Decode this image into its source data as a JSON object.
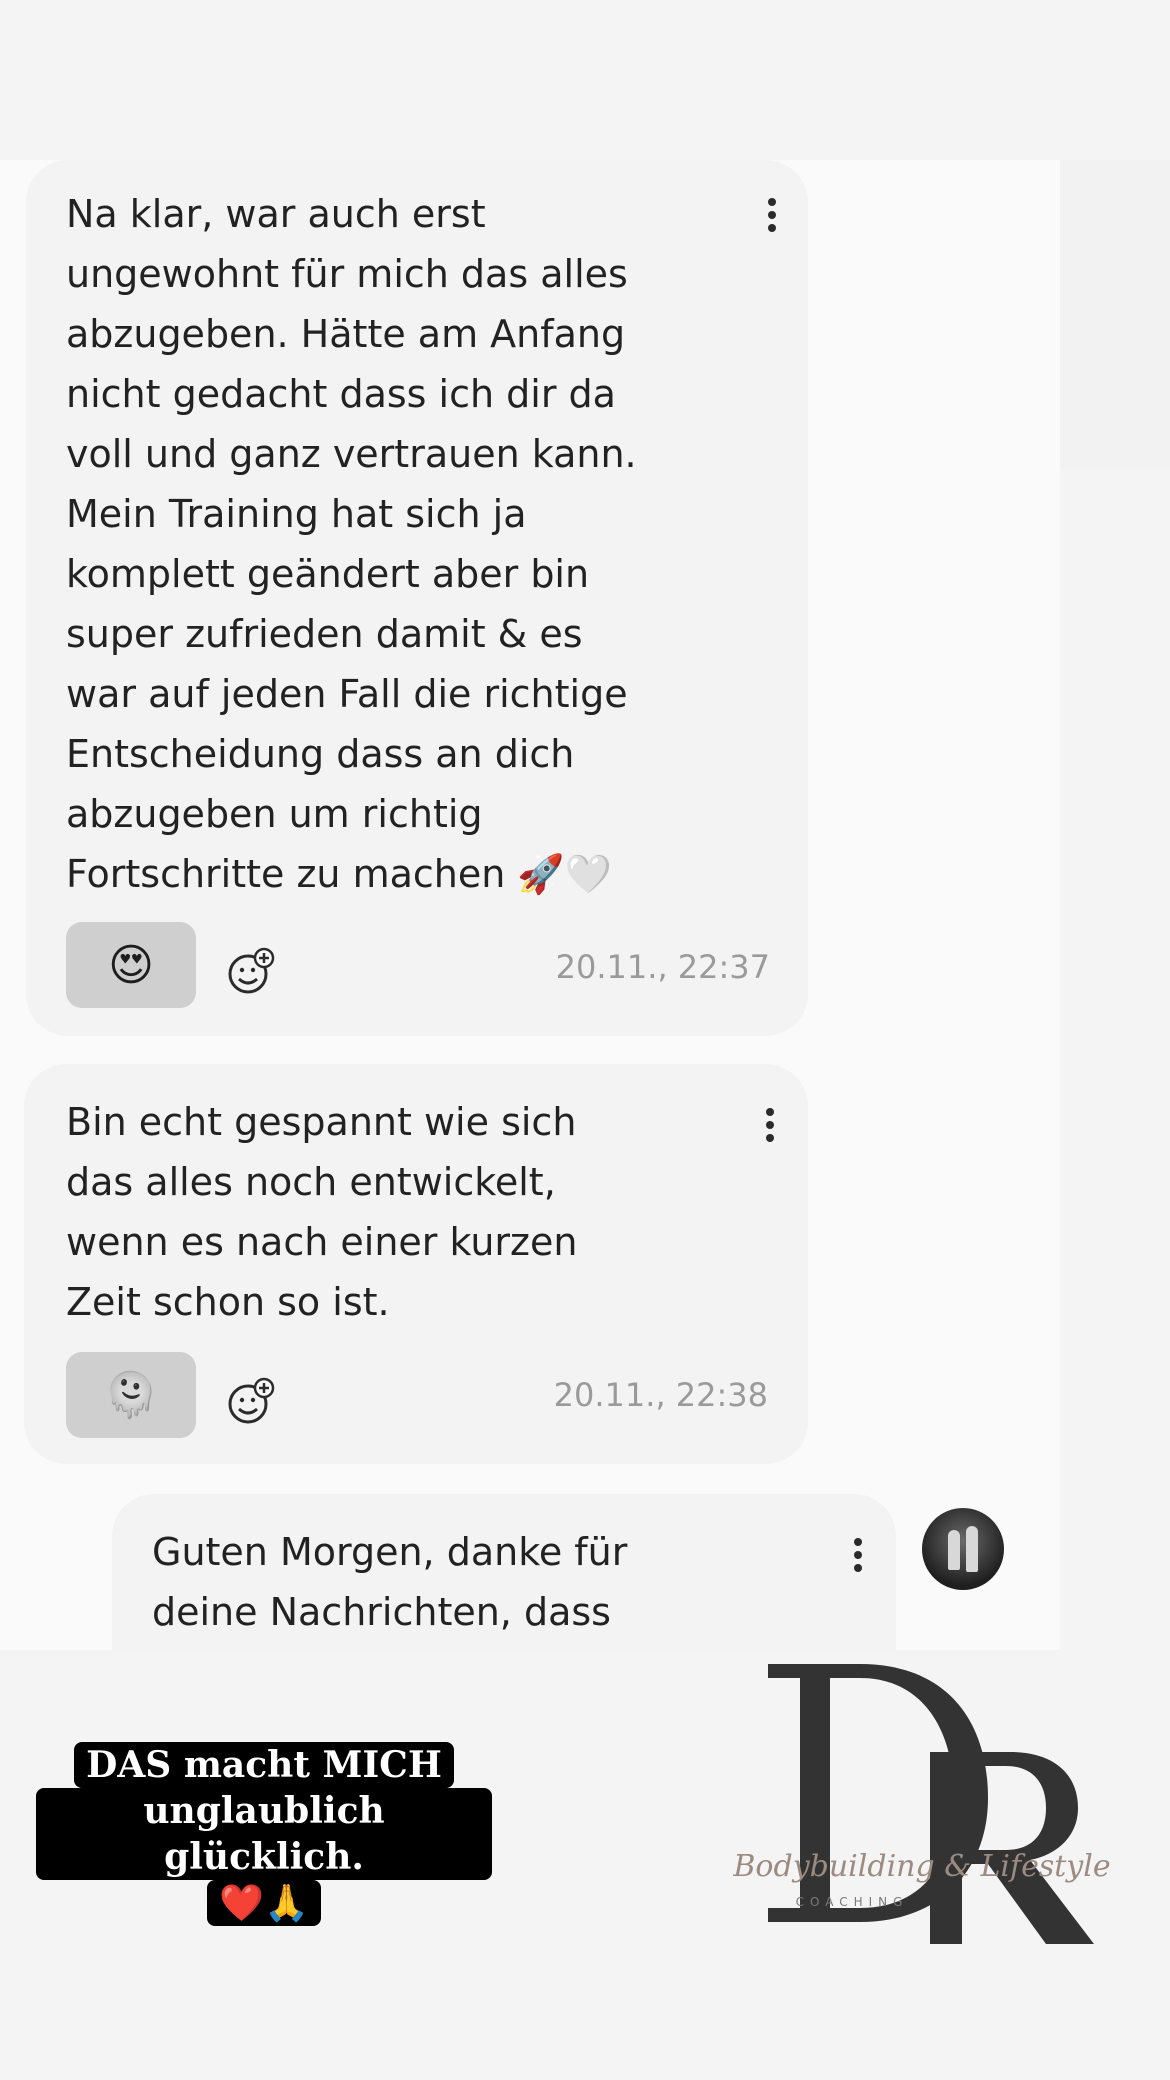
{
  "messages": [
    {
      "text": "Na klar, war auch erst\nungewohnt für mich das alles\nabzugeben. Hätte am Anfang\nnicht gedacht dass ich dir da\nvoll und ganz vertrauen kann.\nMein Training hat sich ja\nkomplett geändert aber bin\nsuper zufrieden damit & es\nwar auf jeden Fall die richtige\nEntscheidung dass an dich\nabzugeben um richtig\nFortschritte zu machen 🚀🤍",
      "reaction": "😍",
      "timestamp": "20.11., 22:37"
    },
    {
      "text": "Bin echt gespannt wie sich\ndas alles noch entwickelt,\nwenn es nach einer kurzen\nZeit schon so ist.",
      "reaction": "🫠",
      "timestamp": "20.11., 22:38"
    },
    {
      "text": "Guten Morgen, danke für\ndeine Nachrichten, dass"
    }
  ],
  "caption": {
    "line1": "DAS macht MICH",
    "line2": "unglaublich glücklich.",
    "line3": "❤️🙏"
  },
  "logo": {
    "letters": "DR",
    "tagline": "Bodybuilding & Lifestyle",
    "subline": "COACHING"
  },
  "icons": {
    "menu": "kebab-menu-icon",
    "add_reaction": "add-reaction-icon"
  },
  "colors": {
    "background": "#f4f4f4",
    "bubble": "#f3f3f3",
    "reaction_chip": "#cfcfcf",
    "timestamp": "#9a9a9a",
    "logo": "#333333",
    "tagline": "#9b8b80"
  }
}
